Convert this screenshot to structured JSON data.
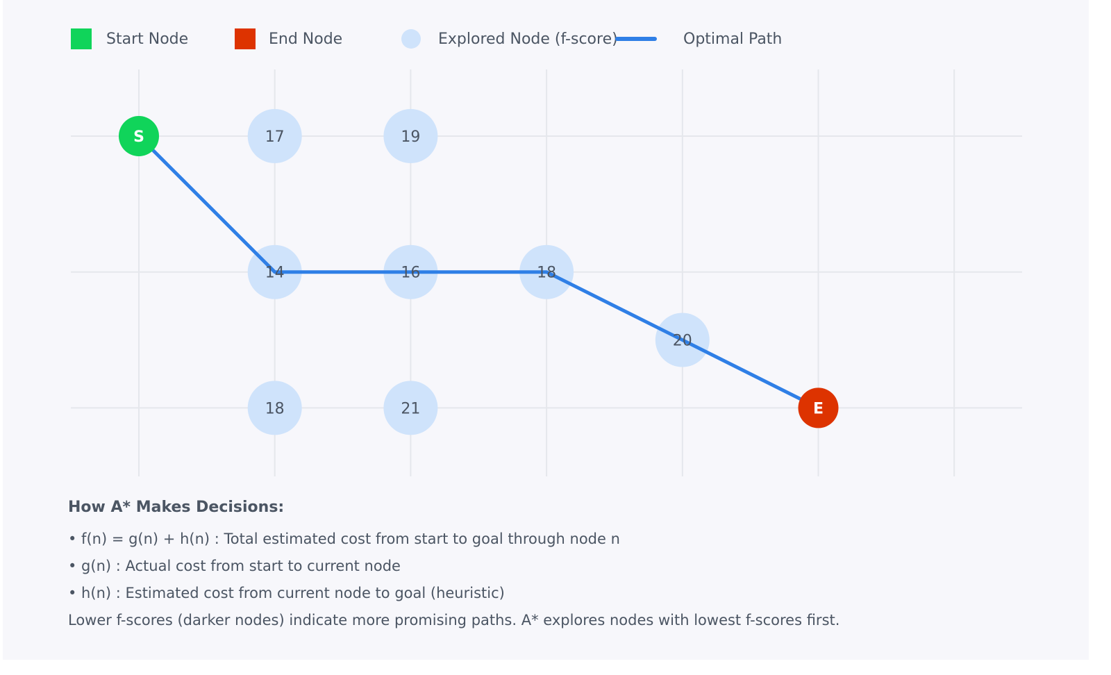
{
  "legend": {
    "start": {
      "label": "Start Node",
      "color": "#10d45a"
    },
    "end": {
      "label": "End Node",
      "color": "#dd3300"
    },
    "explored": {
      "label": "Explored Node (f-score)",
      "color": "#cfe3fb"
    },
    "path": {
      "label": "Optimal Path",
      "color": "#2f7fe6"
    }
  },
  "grid": {
    "cols": 7,
    "rows": 4
  },
  "nodes": [
    {
      "id": "start",
      "col": 0,
      "row": 0,
      "type": "start",
      "label": "S"
    },
    {
      "id": "n-0-1",
      "col": 1,
      "row": 0,
      "type": "explored",
      "label": "17"
    },
    {
      "id": "n-0-2",
      "col": 2,
      "row": 0,
      "type": "explored",
      "label": "19"
    },
    {
      "id": "n-1-1",
      "col": 1,
      "row": 1,
      "type": "explored",
      "label": "14"
    },
    {
      "id": "n-1-2",
      "col": 2,
      "row": 1,
      "type": "explored",
      "label": "16"
    },
    {
      "id": "n-1-3",
      "col": 3,
      "row": 1,
      "type": "explored",
      "label": "18"
    },
    {
      "id": "n-1.5-4",
      "col": 4,
      "row": 1.5,
      "type": "explored",
      "label": "20"
    },
    {
      "id": "n-2-1",
      "col": 1,
      "row": 2,
      "type": "explored",
      "label": "18"
    },
    {
      "id": "n-2-2",
      "col": 2,
      "row": 2,
      "type": "explored",
      "label": "21"
    },
    {
      "id": "end",
      "col": 5,
      "row": 2,
      "type": "end",
      "label": "E"
    }
  ],
  "path": [
    "start",
    "n-1-1",
    "n-1-2",
    "n-1-3",
    "n-1.5-4",
    "end"
  ],
  "explanation": {
    "title": "How A* Makes Decisions:",
    "lines": [
      "• f(n) = g(n) + h(n) : Total estimated cost from start to goal through node n",
      "• g(n) : Actual cost from start to current node",
      "• h(n) : Estimated cost from current node to goal (heuristic)",
      "Lower f-scores (darker nodes) indicate more promising paths. A* explores nodes with lowest f-scores first."
    ]
  }
}
